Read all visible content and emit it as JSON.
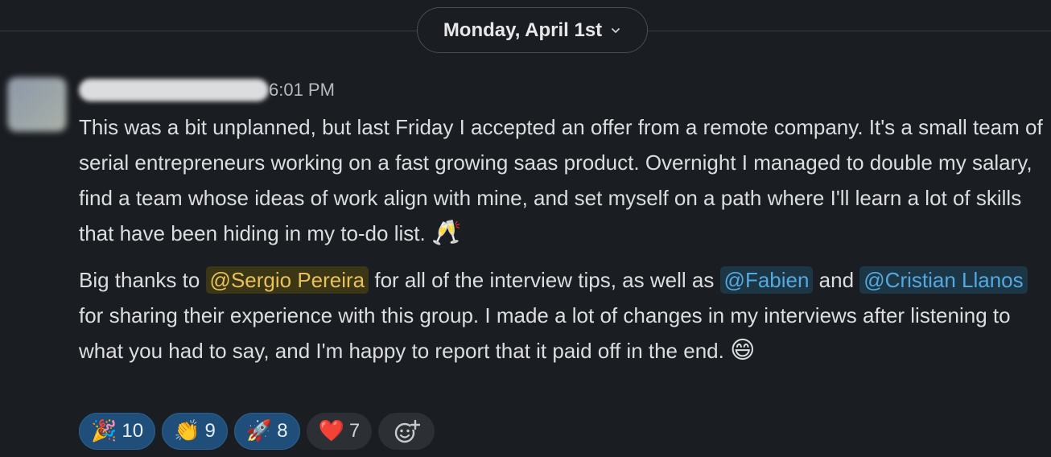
{
  "date_divider": {
    "label": "Monday, April 1st"
  },
  "message": {
    "timestamp": "6:01 PM",
    "paragraph1": "This was a bit unplanned, but last Friday I accepted an offer from a remote company. It's a small team of serial entrepreneurs working on a fast growing saas product. Overnight I managed to double my salary, find a team whose ideas of work align with mine, and set myself on a path where I'll learn a lot of skills that have been hiding in my to-do list.",
    "paragraph1_emoji": "🥂",
    "p2_part1": "Big thanks to ",
    "mention1": "@Sergio Pereira",
    "p2_part2": " for all of the interview tips, as well as ",
    "mention2": "@Fabien",
    "p2_part3": " and ",
    "mention3": "@Cristian Llanos",
    "p2_part4": " for sharing their experience with this group. I made a lot of changes in my interviews after listening to what you had to say, and I'm happy to report that it paid off in the end.",
    "paragraph2_emoji": "😄"
  },
  "reactions": [
    {
      "emoji": "🎉",
      "count": "10",
      "active": true
    },
    {
      "emoji": "👏",
      "count": "9",
      "active": true
    },
    {
      "emoji": "🚀",
      "count": "8",
      "active": true
    },
    {
      "emoji": "❤️",
      "count": "7",
      "active": false
    }
  ],
  "add_reaction_icon": "add-emoji-icon",
  "colors": {
    "background": "#1a1d21",
    "mention_self": "#e8c15a",
    "mention_other": "#53a9e0",
    "reaction_active": "#1f4e7a"
  }
}
